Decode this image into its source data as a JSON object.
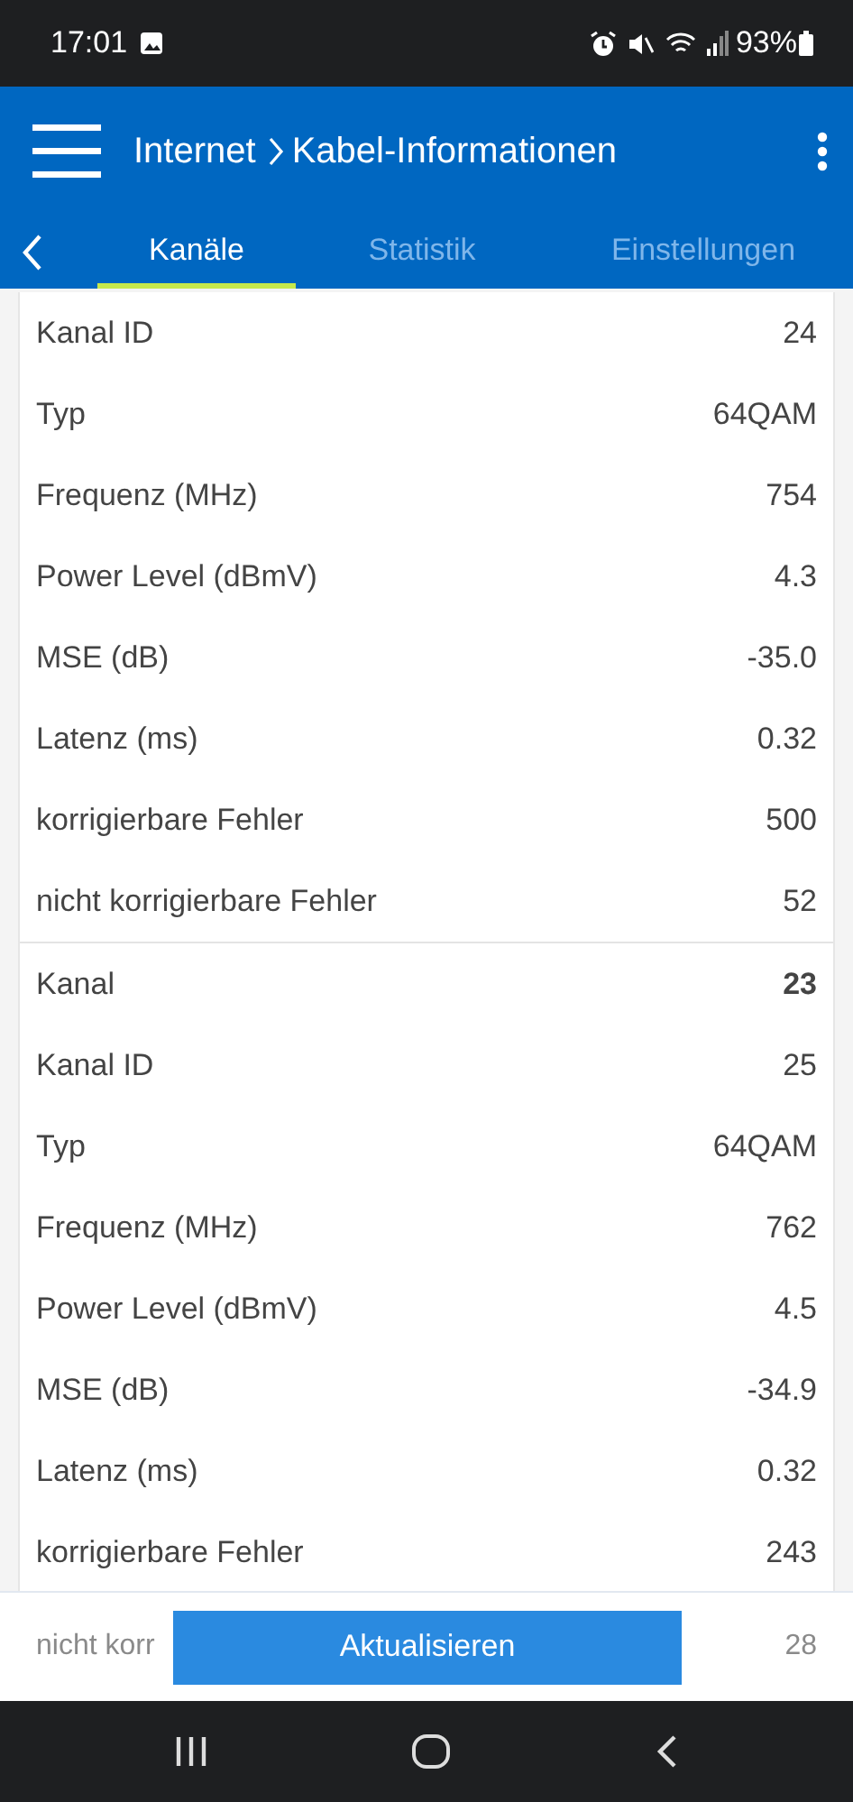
{
  "status_bar": {
    "time": "17:01",
    "battery": "93%"
  },
  "app_bar": {
    "breadcrumb": [
      "Internet",
      "Kabel-Informationen"
    ]
  },
  "tabs": [
    {
      "label": "Kanäle",
      "selected": true
    },
    {
      "label": "Statistik",
      "selected": false
    },
    {
      "label": "Einstellungen",
      "selected": false
    }
  ],
  "groups": [
    {
      "rows": [
        {
          "kind": "field",
          "label": "Kanal ID",
          "value": "24"
        },
        {
          "kind": "field",
          "label": "Typ",
          "value": "64QAM"
        },
        {
          "kind": "field",
          "label": "Frequenz (MHz)",
          "value": "754"
        },
        {
          "kind": "field",
          "label": "Power Level (dBmV)",
          "value": "4.3"
        },
        {
          "kind": "field",
          "label": "MSE (dB)",
          "value": "-35.0"
        },
        {
          "kind": "field",
          "label": "Latenz (ms)",
          "value": "0.32"
        },
        {
          "kind": "field",
          "label": "korrigierbare Fehler",
          "value": "500"
        },
        {
          "kind": "field",
          "label": "nicht korrigierbare Fehler",
          "value": "52"
        }
      ]
    },
    {
      "rows": [
        {
          "kind": "header",
          "label": "Kanal",
          "value": "23"
        },
        {
          "kind": "field",
          "label": "Kanal ID",
          "value": "25"
        },
        {
          "kind": "field",
          "label": "Typ",
          "value": "64QAM"
        },
        {
          "kind": "field",
          "label": "Frequenz (MHz)",
          "value": "762"
        },
        {
          "kind": "field",
          "label": "Power Level (dBmV)",
          "value": "4.5"
        },
        {
          "kind": "field",
          "label": "MSE (dB)",
          "value": "-34.9"
        },
        {
          "kind": "field",
          "label": "Latenz (ms)",
          "value": "0.32"
        },
        {
          "kind": "field",
          "label": "korrigierbare Fehler",
          "value": "243"
        },
        {
          "kind": "peek",
          "label": "nicht korr",
          "value": "28"
        }
      ]
    }
  ],
  "footer": {
    "button": "Aktualisieren"
  }
}
